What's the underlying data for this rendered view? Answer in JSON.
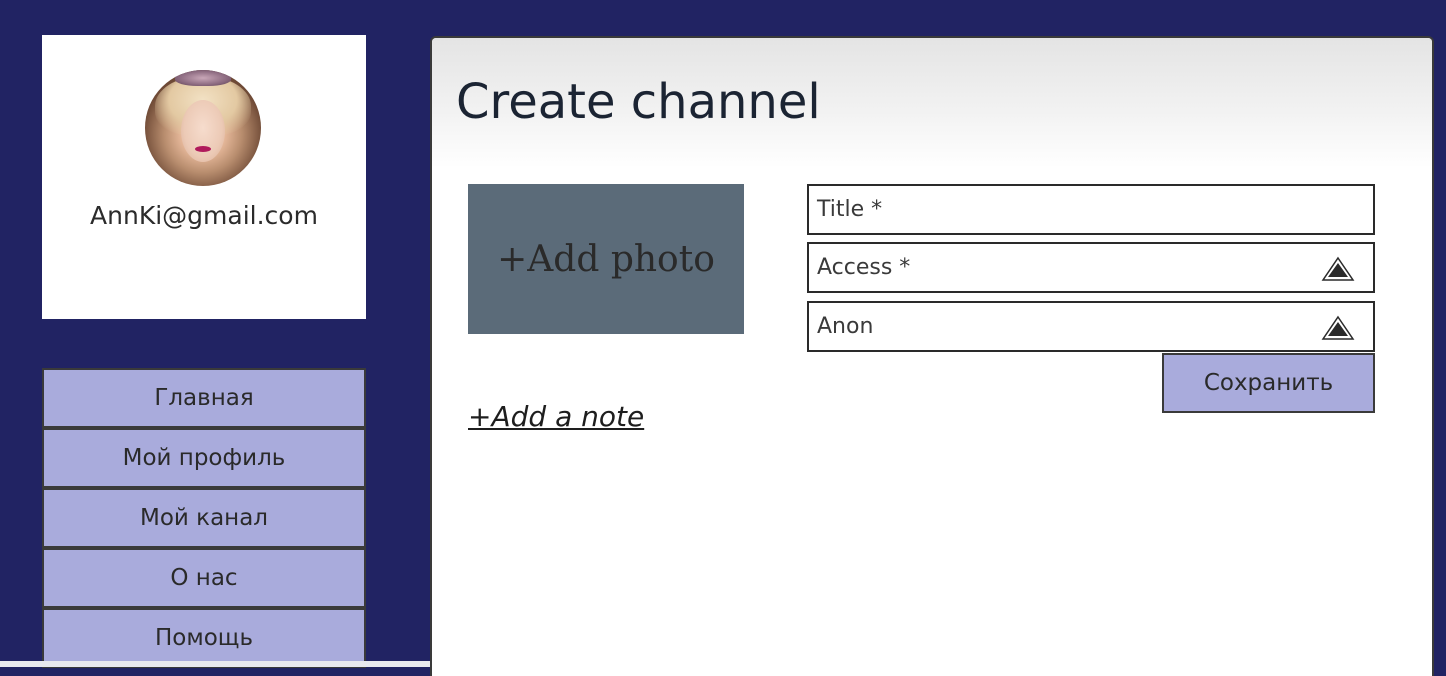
{
  "profile": {
    "email": "AnnKi@gmail.com"
  },
  "nav": {
    "items": [
      {
        "label": "Главная"
      },
      {
        "label": "Мой профиль"
      },
      {
        "label": "Мой канал"
      },
      {
        "label": "О нас"
      },
      {
        "label": "Помощь"
      }
    ]
  },
  "main": {
    "title": "Create channel",
    "add_photo_label": "+Add photo",
    "fields": {
      "title_placeholder": "Title *",
      "access_placeholder": "Access *",
      "anon_value": "Anon"
    },
    "save_label": "Сохранить",
    "add_note_label": "+Add a note"
  },
  "colors": {
    "background": "#212363",
    "nav_button": "#a9abdc",
    "photo_placeholder": "#5b6b79"
  },
  "icons": {
    "dropdown": "triangle-up-icon"
  }
}
